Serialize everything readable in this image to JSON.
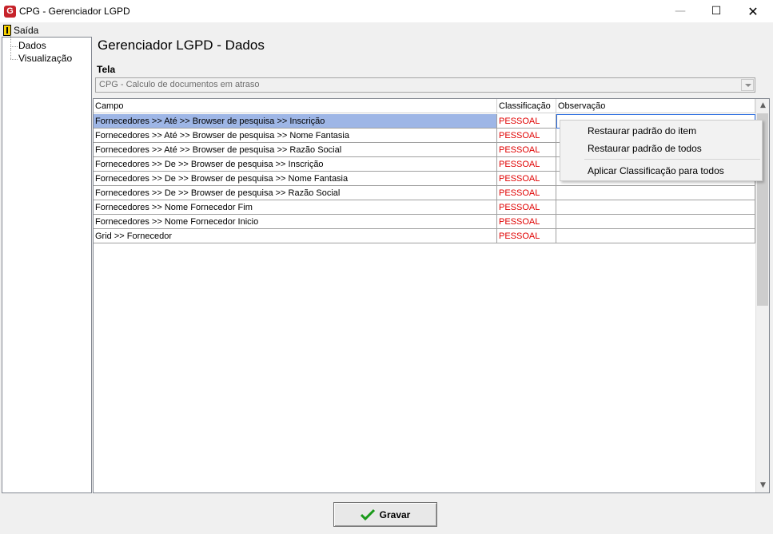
{
  "window": {
    "icon_letter": "G",
    "title": "CPG - Gerenciador LGPD",
    "minimize_icon": "minimize-icon",
    "maximize_icon": "maximize-icon",
    "close_icon": "close-icon"
  },
  "menubar": {
    "exit_label": "Saída"
  },
  "tree": {
    "items": [
      {
        "label": "Dados"
      },
      {
        "label": "Visualização"
      }
    ]
  },
  "main": {
    "title": "Gerenciador LGPD - Dados",
    "tela_label": "Tela",
    "tela_value": "CPG - Calculo de documentos em atraso"
  },
  "grid": {
    "columns": [
      "Campo",
      "Classificação",
      "Observação"
    ],
    "rows": [
      {
        "campo": "Fornecedores >> Até >> Browser de pesquisa >> Inscrição",
        "classificacao": "PESSOAL",
        "observacao": ""
      },
      {
        "campo": "Fornecedores >> Até >> Browser de pesquisa >> Nome Fantasia",
        "classificacao": "PESSOAL",
        "observacao": ""
      },
      {
        "campo": "Fornecedores >> Até >> Browser de pesquisa >> Razão Social",
        "classificacao": "PESSOAL",
        "observacao": ""
      },
      {
        "campo": "Fornecedores >> De >> Browser de pesquisa >> Inscrição",
        "classificacao": "PESSOAL",
        "observacao": ""
      },
      {
        "campo": "Fornecedores >> De >> Browser de pesquisa >> Nome Fantasia",
        "classificacao": "PESSOAL",
        "observacao": ""
      },
      {
        "campo": "Fornecedores >> De >> Browser de pesquisa >> Razão Social",
        "classificacao": "PESSOAL",
        "observacao": ""
      },
      {
        "campo": "Fornecedores >> Nome Fornecedor Fim",
        "classificacao": "PESSOAL",
        "observacao": ""
      },
      {
        "campo": "Fornecedores >> Nome Fornecedor Inicio",
        "classificacao": "PESSOAL",
        "observacao": ""
      },
      {
        "campo": "Grid >> Fornecedor",
        "classificacao": "PESSOAL",
        "observacao": ""
      }
    ],
    "selected_row": 1
  },
  "context_menu": {
    "items": [
      "Restaurar padrão do item",
      "Restaurar padrão de todos",
      "Aplicar Classificação para todos"
    ]
  },
  "footer": {
    "save_label": "Gravar"
  },
  "colors": {
    "classification_text": "#e00000",
    "selected_row": "#9eb6e6",
    "selected_border": "#3070e0",
    "save_check": "#1a9a1a"
  }
}
